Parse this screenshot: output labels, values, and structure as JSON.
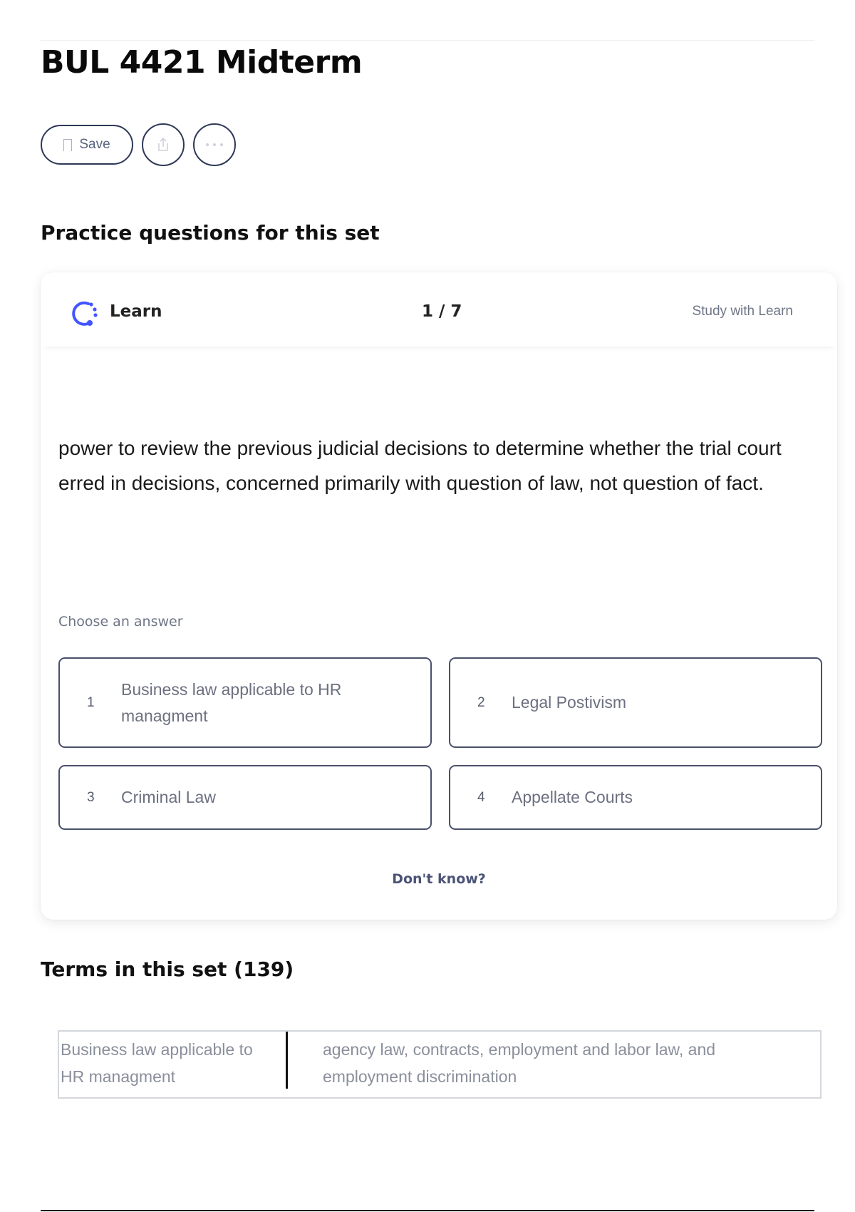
{
  "page": {
    "title": "BUL 4421 Midterm"
  },
  "actions": {
    "save_label": "Save"
  },
  "practice": {
    "heading": "Practice questions for this set",
    "mode_label": "Learn",
    "counter": "1 / 7",
    "study_link": "Study with Learn",
    "question": "power to review the previous judicial decisions to determine whether the trial court erred in decisions, concerned primarily with question of law, not question of fact.",
    "choose_label": "Choose an answer",
    "options": [
      {
        "number": "1",
        "text": "Business law applicable to HR managment"
      },
      {
        "number": "2",
        "text": "Legal Postivism"
      },
      {
        "number": "3",
        "text": "Criminal Law"
      },
      {
        "number": "4",
        "text": "Appellate Courts"
      }
    ],
    "dont_know": "Don't know?"
  },
  "terms": {
    "heading": "Terms in this set (139)",
    "items": [
      {
        "term": "Business law applicable to HR managment",
        "definition": "agency law, contracts, employment and labor law, and employment discrimination"
      }
    ]
  },
  "colors": {
    "learn_accent": "#4255ff",
    "button_border": "#2e3856"
  },
  "icons": {
    "save": "bookmark-icon",
    "share": "share-icon",
    "more": "more-icon",
    "learn": "learn-icon"
  }
}
